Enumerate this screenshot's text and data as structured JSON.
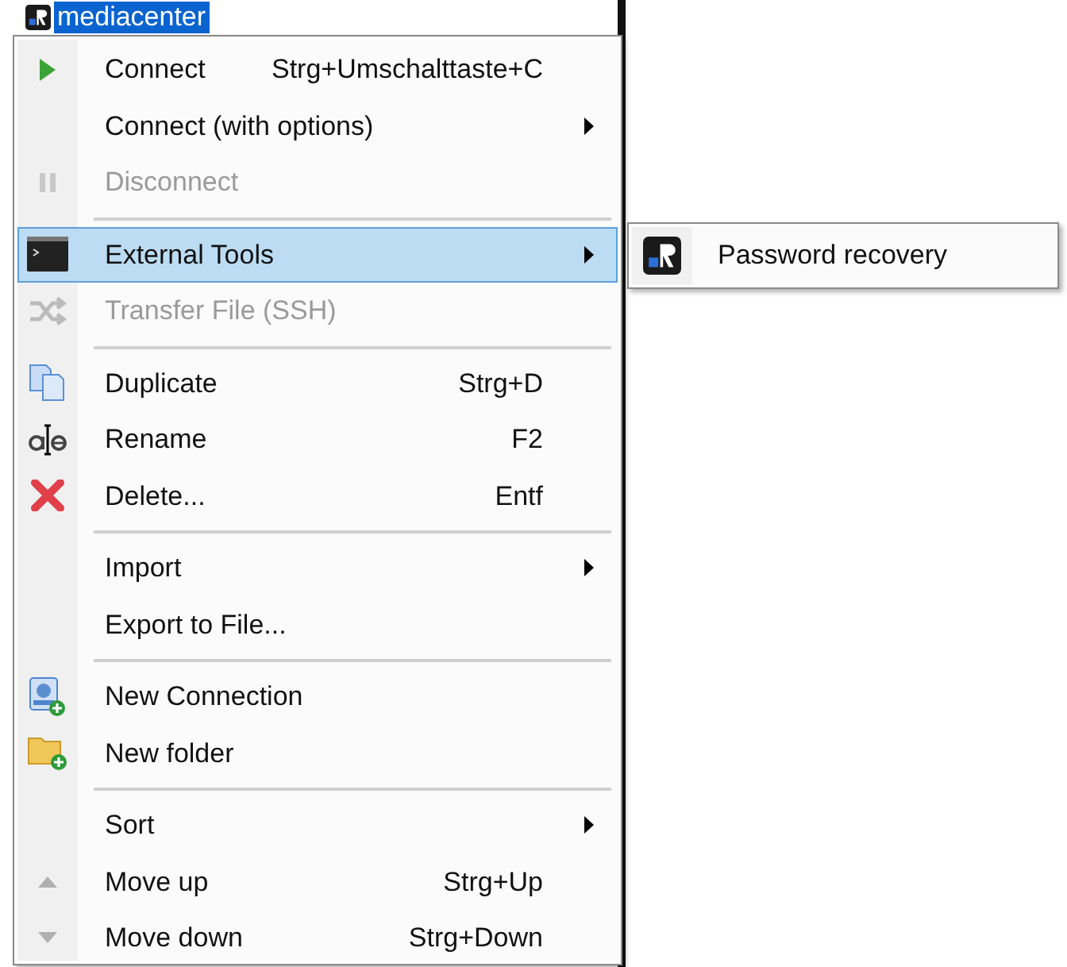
{
  "tree_node": {
    "label": "mediacenter",
    "selected": true
  },
  "menu": [
    {
      "kind": "item",
      "label": "Connect",
      "shortcut": "Strg+Umschalttaste+C",
      "submenu": false,
      "disabled": false,
      "selected": false
    },
    {
      "kind": "item",
      "label": "Connect (with options)",
      "submenu": true,
      "disabled": false,
      "selected": false
    },
    {
      "kind": "item",
      "label": "Disconnect",
      "submenu": false,
      "disabled": true,
      "selected": false
    },
    {
      "kind": "separator"
    },
    {
      "kind": "item",
      "label": "External Tools",
      "submenu": true,
      "disabled": false,
      "selected": true
    },
    {
      "kind": "item",
      "label": "Transfer File (SSH)",
      "submenu": false,
      "disabled": true,
      "selected": false
    },
    {
      "kind": "separator"
    },
    {
      "kind": "item",
      "label": "Duplicate",
      "shortcut": "Strg+D",
      "submenu": false,
      "disabled": false,
      "selected": false
    },
    {
      "kind": "item",
      "label": "Rename",
      "shortcut": "F2",
      "submenu": false,
      "disabled": false,
      "selected": false
    },
    {
      "kind": "item",
      "label": "Delete...",
      "shortcut": "Entf",
      "submenu": false,
      "disabled": false,
      "selected": false
    },
    {
      "kind": "separator"
    },
    {
      "kind": "item",
      "label": "Import",
      "submenu": true,
      "disabled": false,
      "selected": false
    },
    {
      "kind": "item",
      "label": "Export to File...",
      "submenu": false,
      "disabled": false,
      "selected": false
    },
    {
      "kind": "separator"
    },
    {
      "kind": "item",
      "label": "New Connection",
      "submenu": false,
      "disabled": false,
      "selected": false
    },
    {
      "kind": "item",
      "label": "New folder",
      "submenu": false,
      "disabled": false,
      "selected": false
    },
    {
      "kind": "separator"
    },
    {
      "kind": "item",
      "label": "Sort",
      "submenu": true,
      "disabled": false,
      "selected": false
    },
    {
      "kind": "item",
      "label": "Move up",
      "shortcut": "Strg+Up",
      "submenu": false,
      "disabled": false,
      "selected": false
    },
    {
      "kind": "item",
      "label": "Move down",
      "shortcut": "Strg+Down",
      "submenu": false,
      "disabled": false,
      "selected": false
    }
  ],
  "submenu": [
    {
      "label": "Password recovery",
      "selected": false
    }
  ]
}
